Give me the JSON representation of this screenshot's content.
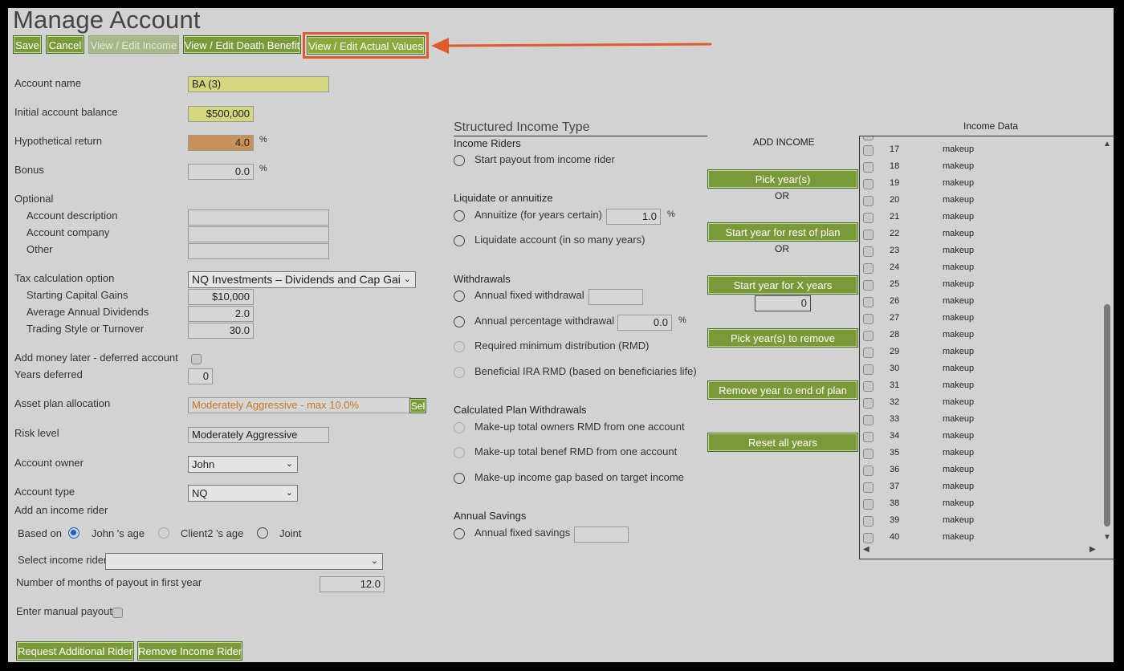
{
  "page": {
    "title": "Manage Account"
  },
  "toolbar": {
    "save": "Save",
    "cancel": "Cancel",
    "edit_income": "View / Edit Income",
    "edit_death_benefit": "View / Edit Death Benefit",
    "edit_actual_values": "View / Edit Actual Values"
  },
  "form": {
    "account_name_label": "Account name",
    "account_name_value": "BA (3)",
    "initial_balance_label": "Initial account balance",
    "initial_balance_value": "$500,000",
    "hypothetical_return_label": "Hypothetical return",
    "hypothetical_return_value": "4.0",
    "bonus_label": "Bonus",
    "bonus_value": "0.0",
    "percent": "%",
    "optional_label": "Optional",
    "account_description_label": "Account description",
    "account_company_label": "Account company",
    "other_label": "Other",
    "tax_option_label": "Tax calculation option",
    "tax_option_value": "NQ Investments – Dividends and Cap Gai",
    "starting_cap_gains_label": "Starting Capital Gains",
    "starting_cap_gains_value": "$10,000",
    "avg_dividends_label": "Average Annual Dividends",
    "avg_dividends_value": "2.0",
    "trading_style_label": "Trading Style or Turnover",
    "trading_style_value": "30.0",
    "add_money_later_label": "Add money later - deferred account",
    "years_deferred_label": "Years deferred",
    "years_deferred_value": "0",
    "asset_plan_label": "Asset plan allocation",
    "asset_plan_value": "Moderately Aggressive - max 10.0%",
    "asset_plan_select_btn": "Sel",
    "risk_level_label": "Risk level",
    "risk_level_value": "Moderately Aggressive",
    "account_owner_label": "Account owner",
    "account_owner_value": "John",
    "account_type_label": "Account type",
    "account_type_value": "NQ",
    "add_income_rider_label": "Add an income rider",
    "based_on_label": "Based on",
    "based_on_options": [
      "John 's age",
      "Client2 's age",
      "Joint"
    ],
    "select_rider_label": "Select income rider",
    "select_rider_value": "",
    "months_payout_label": "Number of months of payout in first year",
    "months_payout_value": "12.0",
    "manual_payout_label": "Enter manual payout",
    "request_rider_btn": "Request Additional Rider",
    "remove_rider_btn": "Remove Income Rider"
  },
  "structured": {
    "title": "Structured Income Type",
    "income_riders_head": "Income Riders",
    "start_payout": "Start payout from income rider",
    "liquidate_head": "Liquidate or annuitize",
    "annuitize": "Annuitize (for years certain)",
    "annuitize_value": "1.0",
    "liquidate": "Liquidate account (in so many years)",
    "withdrawals_head": "Withdrawals",
    "fixed_withdrawal": "Annual fixed withdrawal",
    "pct_withdrawal": "Annual percentage withdrawal",
    "pct_withdrawal_value": "0.0",
    "rmd": "Required minimum distribution (RMD)",
    "beneficial_rmd": "Beneficial IRA RMD (based on beneficiaries life)",
    "calc_head": "Calculated Plan Withdrawals",
    "makeup_owners": "Make-up total owners RMD from one account",
    "makeup_benef": "Make-up total benef RMD from one account",
    "makeup_gap": "Make-up income gap based on target income",
    "savings_head": "Annual Savings",
    "fixed_savings": "Annual fixed savings"
  },
  "add_income": {
    "head": "ADD INCOME",
    "pick_years": "Pick year(s)",
    "or": "OR",
    "start_rest": "Start year for rest of plan",
    "start_x": "Start year for X years",
    "x_years_value": "0",
    "pick_remove": "Pick year(s) to remove",
    "remove_end": "Remove year to end of plan",
    "reset": "Reset all years"
  },
  "income_data": {
    "title": "Income Data",
    "rows": [
      {
        "year": "17",
        "type": "makeup"
      },
      {
        "year": "18",
        "type": "makeup"
      },
      {
        "year": "19",
        "type": "makeup"
      },
      {
        "year": "20",
        "type": "makeup"
      },
      {
        "year": "21",
        "type": "makeup"
      },
      {
        "year": "22",
        "type": "makeup"
      },
      {
        "year": "23",
        "type": "makeup"
      },
      {
        "year": "24",
        "type": "makeup"
      },
      {
        "year": "25",
        "type": "makeup"
      },
      {
        "year": "26",
        "type": "makeup"
      },
      {
        "year": "27",
        "type": "makeup"
      },
      {
        "year": "28",
        "type": "makeup"
      },
      {
        "year": "29",
        "type": "makeup"
      },
      {
        "year": "30",
        "type": "makeup"
      },
      {
        "year": "31",
        "type": "makeup"
      },
      {
        "year": "32",
        "type": "makeup"
      },
      {
        "year": "33",
        "type": "makeup"
      },
      {
        "year": "34",
        "type": "makeup"
      },
      {
        "year": "35",
        "type": "makeup"
      },
      {
        "year": "36",
        "type": "makeup"
      },
      {
        "year": "37",
        "type": "makeup"
      },
      {
        "year": "38",
        "type": "makeup"
      },
      {
        "year": "39",
        "type": "makeup"
      },
      {
        "year": "40",
        "type": "makeup"
      }
    ]
  },
  "colors": {
    "button": "#7a9a3a",
    "highlight": "#e05a2c",
    "yellow_field": "#d5d77e",
    "orange_field": "#c8915a"
  }
}
